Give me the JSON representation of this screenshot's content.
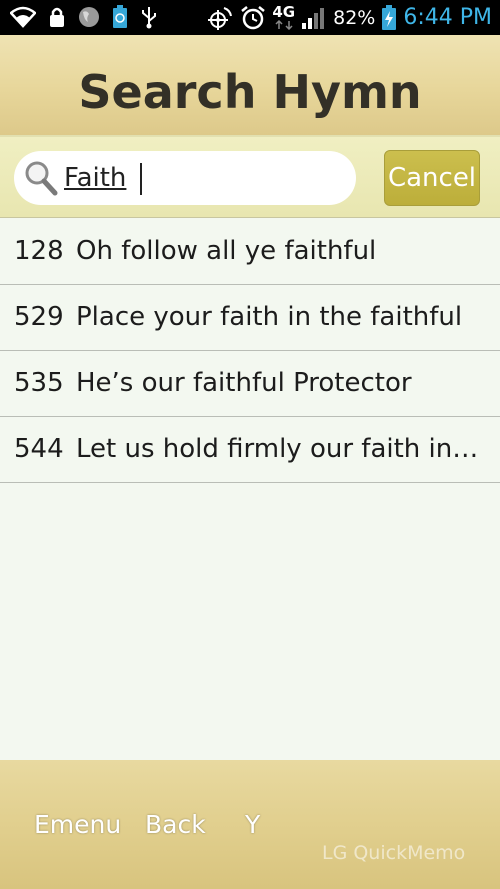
{
  "status_bar": {
    "icons": [
      "wifi-icon",
      "lock-icon",
      "globe-icon",
      "battery-saver-icon",
      "usb-icon",
      "gps-icon",
      "alarm-icon",
      "network-4g-icon",
      "signal-icon",
      "battery-charging-icon"
    ],
    "network_label": "4G",
    "battery_percent": "82%",
    "time": "6:44 PM",
    "time_color": "#3fb6e8"
  },
  "header": {
    "title": "Search Hymn"
  },
  "search": {
    "value": "Faith",
    "cancel_label": "Cancel",
    "accent_color": "#c4b644"
  },
  "results": [
    {
      "number": "128",
      "title": "Oh follow all ye faithful"
    },
    {
      "number": "529",
      "title": "Place your faith in the faithful"
    },
    {
      "number": "535",
      "title": "He’s our faithful Protector"
    },
    {
      "number": "544",
      "title": "Let us hold firmly our faith in…"
    }
  ],
  "bottom_bar": {
    "items": [
      "Emenu",
      "Back",
      "Y"
    ],
    "watermark": "LG QuickMemo"
  }
}
